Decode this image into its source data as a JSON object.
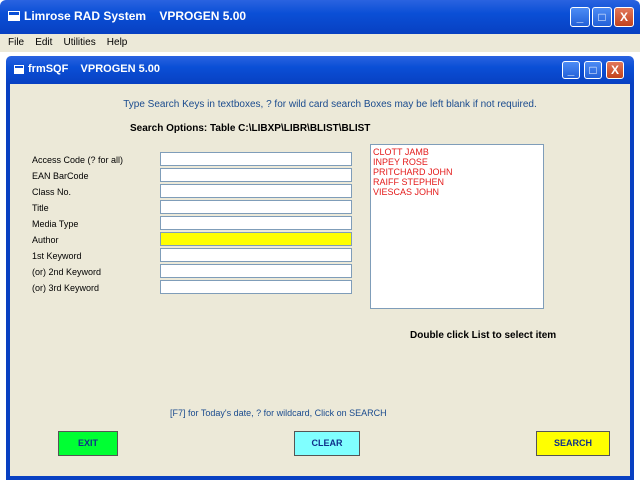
{
  "window": {
    "title": "Limrose RAD System    VPROGEN 5.00",
    "minimize_label": "_",
    "maximize_label": "□",
    "close_label": "X"
  },
  "menu": {
    "items": [
      {
        "label": "File"
      },
      {
        "label": "Edit"
      },
      {
        "label": "Utilities"
      },
      {
        "label": "Help"
      }
    ]
  },
  "form": {
    "title": "frmSQF    VPROGEN 5.00",
    "instructions": "Type Search Keys in textboxes, ? for wild card search Boxes may be left blank if not required.",
    "search_options": "Search Options:   Table C:\\LIBXP\\LIBR\\BLIST\\BLIST",
    "fields": [
      {
        "label": "Access Code (? for all)",
        "value": ""
      },
      {
        "label": "EAN BarCode",
        "value": ""
      },
      {
        "label": "Class No.",
        "value": ""
      },
      {
        "label": "Title",
        "value": ""
      },
      {
        "label": "Media Type",
        "value": ""
      },
      {
        "label": "Author",
        "value": ""
      },
      {
        "label": "1st Keyword",
        "value": ""
      },
      {
        "label": "(or) 2nd Keyword",
        "value": ""
      },
      {
        "label": "(or) 3rd Keyword",
        "value": ""
      }
    ],
    "list_items": [
      "CLOTT JAMB",
      "INPEY ROSE",
      "PRITCHARD JOHN",
      "RAIFF STEPHEN",
      "VIESCAS JOHN"
    ],
    "double_click_hint": "Double click List to select item",
    "f7_hint": "[F7] for Today's date, ? for wildcard, Click on SEARCH",
    "buttons": {
      "exit": "EXIT",
      "clear": "CLEAR",
      "search": "SEARCH"
    }
  }
}
